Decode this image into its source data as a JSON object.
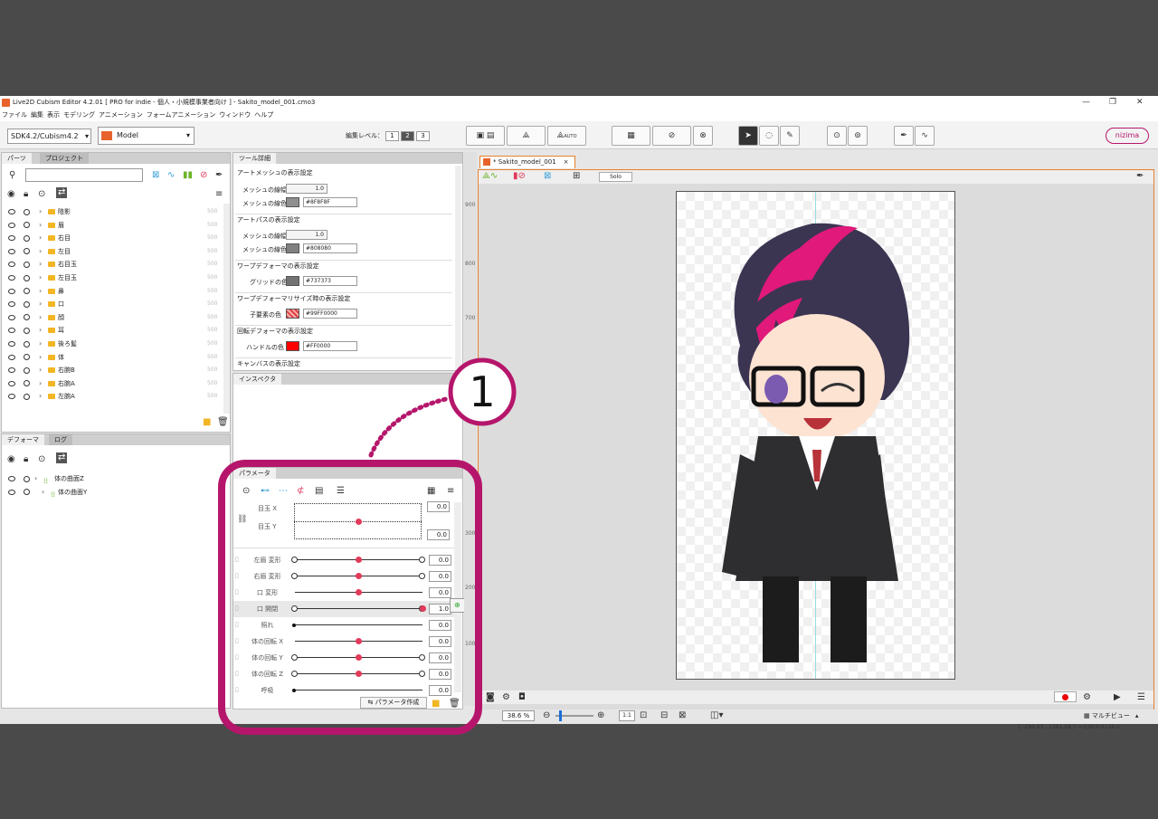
{
  "window": {
    "title": "Live2D Cubism Editor 4.2.01  [ PRO for indie - 個人・小規模事業者向け ] - Sakito_model_001.cmo3"
  },
  "menu": [
    "ファイル",
    "編集",
    "表示",
    "モデリング",
    "アニメーション",
    "フォームアニメーション",
    "ウィンドウ",
    "ヘルプ"
  ],
  "toolbar": {
    "sdk": "SDK4.2/Cubism4.2",
    "mode": "Model",
    "edit_level_label": "編集レベル：",
    "levels": [
      "1",
      "2",
      "3"
    ],
    "user": "nizima",
    "auto": "AUTO"
  },
  "colors": {
    "accent": "#e8632b",
    "brand_magenta": "#b5166b",
    "param_dot": "#e23a5a"
  },
  "parts_panel": {
    "tabs": [
      "パーツ",
      "プロジェクト"
    ],
    "items": [
      {
        "name": "陰影",
        "num": "500"
      },
      {
        "name": "眉",
        "num": "500"
      },
      {
        "name": "右目",
        "num": "500"
      },
      {
        "name": "左目",
        "num": "500"
      },
      {
        "name": "右目玉",
        "num": "500"
      },
      {
        "name": "左目玉",
        "num": "500"
      },
      {
        "name": "鼻",
        "num": "500"
      },
      {
        "name": "口",
        "num": "500"
      },
      {
        "name": "顔",
        "num": "500"
      },
      {
        "name": "耳",
        "num": "500"
      },
      {
        "name": "後ろ髪",
        "num": "500"
      },
      {
        "name": "体",
        "num": "500"
      },
      {
        "name": "右腕B",
        "num": "500"
      },
      {
        "name": "右腕A",
        "num": "500"
      },
      {
        "name": "左腕A",
        "num": "500"
      }
    ]
  },
  "deformer_panel": {
    "tabs": [
      "デフォーマ",
      "ログ"
    ],
    "items": [
      {
        "name": "体の曲面Z"
      },
      {
        "name": "体の曲面Y"
      }
    ]
  },
  "tool_details": {
    "tab": "ツール詳細",
    "sections": {
      "art_mesh": {
        "title": "アートメッシュの表示設定",
        "width_label": "メッシュの線幅",
        "width": "1.0",
        "color_label": "メッシュの線色",
        "color_hex": "#8F8F8F",
        "color": "#8f8f8f"
      },
      "art_path": {
        "title": "アートパスの表示設定",
        "width_label": "メッシュの線幅",
        "width": "1.0",
        "color_label": "メッシュの線色",
        "color_hex": "#808080",
        "color": "#808080"
      },
      "warp": {
        "title": "ワープデフォーマの表示設定",
        "color_label": "グリッドの色",
        "color_hex": "#737373",
        "color": "#737373"
      },
      "warp_resize": {
        "title": "ワープデフォーマリサイズ時の表示設定",
        "color_label": "子要素の色",
        "color_hex": "#99FF0000",
        "color": "#e04040"
      },
      "rotation": {
        "title": "回転デフォーマの表示設定",
        "color_label": "ハンドルの色",
        "color_hex": "#FF0000",
        "color": "#ff0000"
      },
      "canvas": {
        "title": "キャンバスの表示設定"
      }
    }
  },
  "inspector": {
    "tab": "インスペクタ"
  },
  "params": {
    "tab": "パラメータ",
    "eye_x": "目玉 X",
    "eye_y": "目玉 Y",
    "eye_x_val": "0.0",
    "eye_y_val": "0.0",
    "rows": [
      {
        "name": "左眉 変形",
        "value": "0.0",
        "pos": 0.5,
        "two_knots": true
      },
      {
        "name": "右眉 変形",
        "value": "0.0",
        "pos": 0.5,
        "two_knots": true
      },
      {
        "name": "口 変形",
        "value": "0.0",
        "pos": 0.5,
        "two_knots": false
      },
      {
        "name": "口 開閉",
        "value": "1.0",
        "pos": 1.0,
        "two_knots": true,
        "selected": true
      },
      {
        "name": "照れ",
        "value": "0.0",
        "pos": 0.0,
        "two_knots": false
      },
      {
        "name": "体の回転 X",
        "value": "0.0",
        "pos": 0.5,
        "two_knots": false
      },
      {
        "name": "体の回転 Y",
        "value": "0.0",
        "pos": 0.5,
        "two_knots": true
      },
      {
        "name": "体の回転 Z",
        "value": "0.0",
        "pos": 0.5,
        "two_knots": true
      },
      {
        "name": "呼吸",
        "value": "0.0",
        "pos": 0.0,
        "two_knots": false
      }
    ],
    "create_label": "パラメータ作成"
  },
  "canvas": {
    "tab": "* Sakito_model_001",
    "solo": "Solo",
    "ruler": [
      "900",
      "800",
      "700",
      "300",
      "200",
      "100"
    ]
  },
  "status": {
    "zoom": "38.6 %",
    "ratio": "1:1",
    "view": "マルチビュー",
    "coords": "[ -296.93 , 1381.28 ]",
    "size": "=538(8)4136.0"
  },
  "callout": {
    "number": "1"
  }
}
